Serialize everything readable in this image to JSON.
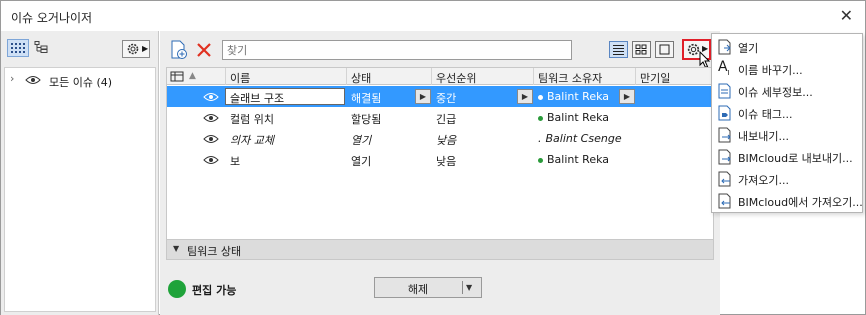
{
  "window": {
    "title": "이슈 오거나이저"
  },
  "tree": {
    "root_label": "모든 이슈 (4)"
  },
  "search": {
    "placeholder": "찾기"
  },
  "table": {
    "columns": [
      "이름",
      "상태",
      "우선순위",
      "팀워크 소유자",
      "만기일"
    ],
    "rows": [
      {
        "name": "슬래브 구조",
        "status": "해결됨",
        "priority": "중간",
        "owner": "Balint Reka"
      },
      {
        "name": "컬럼 위치",
        "status": "할당됨",
        "priority": "긴급",
        "owner": "Balint Reka"
      },
      {
        "name": "의자 교체",
        "status": "열기",
        "priority": "낮음",
        "owner": "Balint Csenge"
      },
      {
        "name": "보",
        "status": "열기",
        "priority": "낮음",
        "owner": "Balint Reka"
      }
    ]
  },
  "teamwork": {
    "section_label": "팀워크 상태",
    "status_text": "편집 가능",
    "release_label": "해제"
  },
  "menu": {
    "items": [
      {
        "label": "열기",
        "icon": "open-icon"
      },
      {
        "label": "이름 바꾸기...",
        "icon": "rename-icon"
      },
      {
        "label": "이슈 세부정보...",
        "icon": "details-icon"
      },
      {
        "label": "이슈 태그...",
        "icon": "tag-icon"
      },
      {
        "label": "내보내기...",
        "icon": "export-icon"
      },
      {
        "label": "BIMcloud로 내보내기...",
        "icon": "bimcloud-export-icon"
      },
      {
        "label": "가져오기...",
        "icon": "import-icon"
      },
      {
        "label": "BIMcloud에서 가져오기...",
        "icon": "bimcloud-import-icon"
      }
    ]
  },
  "colors": {
    "selection": "#3399ff",
    "status_green": "#1fa33a",
    "highlight_red": "#e0202a"
  }
}
